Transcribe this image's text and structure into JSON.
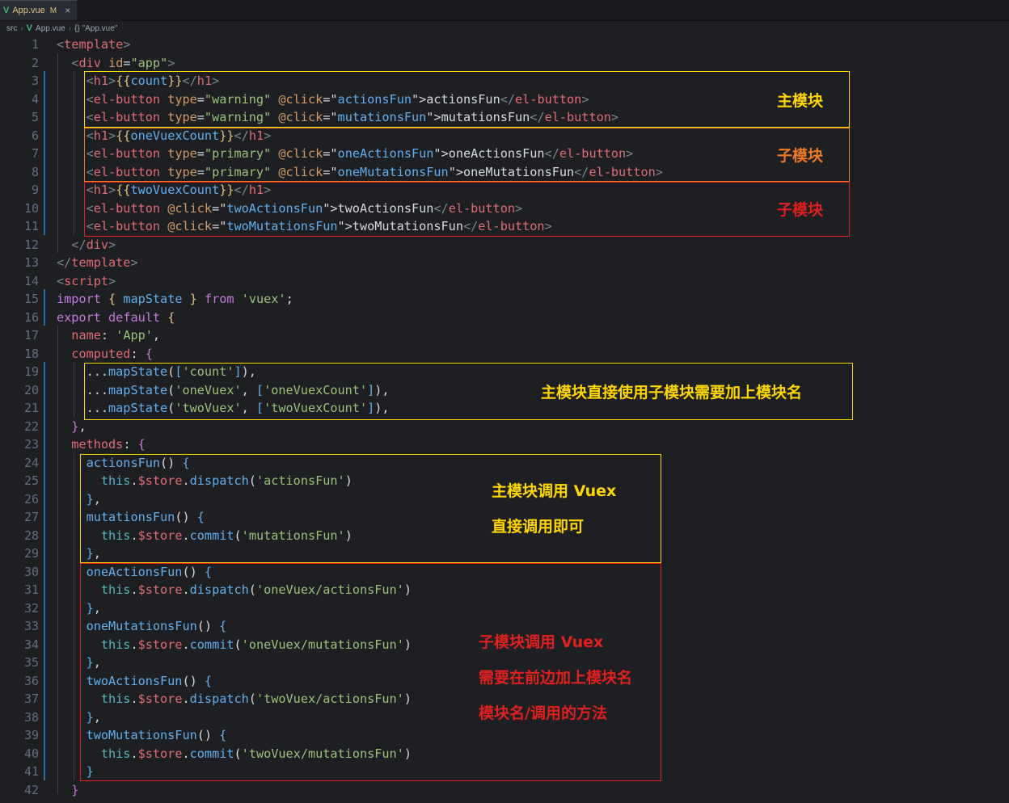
{
  "tab": {
    "icon": "vue-icon",
    "filename": "App.vue",
    "modified": "M",
    "close": "×"
  },
  "breadcrumb": {
    "folder": "src",
    "file": "App.vue",
    "symbol": "{} \"App.vue\""
  },
  "line_numbers": [
    "1",
    "2",
    "3",
    "4",
    "5",
    "6",
    "7",
    "8",
    "9",
    "10",
    "11",
    "12",
    "13",
    "14",
    "15",
    "16",
    "17",
    "18",
    "19",
    "20",
    "21",
    "22",
    "23",
    "24",
    "25",
    "26",
    "27",
    "28",
    "29",
    "30",
    "31",
    "32",
    "33",
    "34",
    "35",
    "36",
    "37",
    "38",
    "39",
    "40",
    "41",
    "42"
  ],
  "code_lines": [
    [
      [
        "tg",
        "<"
      ],
      [
        "tn",
        "template"
      ],
      [
        "tg",
        ">"
      ]
    ],
    [
      [
        "pl",
        "  "
      ],
      [
        "tg",
        "<"
      ],
      [
        "tn",
        "div"
      ],
      [
        "pl",
        " "
      ],
      [
        "at",
        "id"
      ],
      [
        "pl",
        "="
      ],
      [
        "sv",
        "\"app\""
      ],
      [
        "tg",
        ">"
      ]
    ],
    [
      [
        "pl",
        "    "
      ],
      [
        "tg",
        "<"
      ],
      [
        "tn",
        "h1"
      ],
      [
        "tg",
        ">"
      ],
      [
        "br",
        "{{"
      ],
      [
        "bv",
        "count"
      ],
      [
        "br",
        "}}"
      ],
      [
        "tg",
        "</"
      ],
      [
        "tn",
        "h1"
      ],
      [
        "tg",
        ">"
      ]
    ],
    [
      [
        "pl",
        "    "
      ],
      [
        "tg",
        "<"
      ],
      [
        "tn",
        "el-button"
      ],
      [
        "pl",
        " "
      ],
      [
        "at",
        "type"
      ],
      [
        "pl",
        "="
      ],
      [
        "sv",
        "\"warning\""
      ],
      [
        "pl",
        " "
      ],
      [
        "at",
        "@click"
      ],
      [
        "pl",
        "=\""
      ],
      [
        "bv",
        "actionsFun"
      ],
      [
        "pl",
        "\">actionsFun"
      ],
      [
        "tg",
        "</"
      ],
      [
        "tn",
        "el-button"
      ],
      [
        "tg",
        ">"
      ]
    ],
    [
      [
        "pl",
        "    "
      ],
      [
        "tg",
        "<"
      ],
      [
        "tn",
        "el-button"
      ],
      [
        "pl",
        " "
      ],
      [
        "at",
        "type"
      ],
      [
        "pl",
        "="
      ],
      [
        "sv",
        "\"warning\""
      ],
      [
        "pl",
        " "
      ],
      [
        "at",
        "@click"
      ],
      [
        "pl",
        "=\""
      ],
      [
        "bv",
        "mutationsFun"
      ],
      [
        "pl",
        "\">mutationsFun"
      ],
      [
        "tg",
        "</"
      ],
      [
        "tn",
        "el-button"
      ],
      [
        "tg",
        ">"
      ]
    ],
    [
      [
        "pl",
        "    "
      ],
      [
        "tg",
        "<"
      ],
      [
        "tn",
        "h1"
      ],
      [
        "tg",
        ">"
      ],
      [
        "br",
        "{{"
      ],
      [
        "bv",
        "oneVuexCount"
      ],
      [
        "br",
        "}}"
      ],
      [
        "tg",
        "</"
      ],
      [
        "tn",
        "h1"
      ],
      [
        "tg",
        ">"
      ]
    ],
    [
      [
        "pl",
        "    "
      ],
      [
        "tg",
        "<"
      ],
      [
        "tn",
        "el-button"
      ],
      [
        "pl",
        " "
      ],
      [
        "at",
        "type"
      ],
      [
        "pl",
        "="
      ],
      [
        "sv",
        "\"primary\""
      ],
      [
        "pl",
        " "
      ],
      [
        "at",
        "@click"
      ],
      [
        "pl",
        "=\""
      ],
      [
        "bv",
        "oneActionsFun"
      ],
      [
        "pl",
        "\">oneActionsFun"
      ],
      [
        "tg",
        "</"
      ],
      [
        "tn",
        "el-button"
      ],
      [
        "tg",
        ">"
      ]
    ],
    [
      [
        "pl",
        "    "
      ],
      [
        "tg",
        "<"
      ],
      [
        "tn",
        "el-button"
      ],
      [
        "pl",
        " "
      ],
      [
        "at",
        "type"
      ],
      [
        "pl",
        "="
      ],
      [
        "sv",
        "\"primary\""
      ],
      [
        "pl",
        " "
      ],
      [
        "at",
        "@click"
      ],
      [
        "pl",
        "=\""
      ],
      [
        "bv",
        "oneMutationsFun"
      ],
      [
        "pl",
        "\">oneMutationsFun"
      ],
      [
        "tg",
        "</"
      ],
      [
        "tn",
        "el-button"
      ],
      [
        "tg",
        ">"
      ]
    ],
    [
      [
        "pl",
        "    "
      ],
      [
        "tg",
        "<"
      ],
      [
        "tn",
        "h1"
      ],
      [
        "tg",
        ">"
      ],
      [
        "br",
        "{{"
      ],
      [
        "bv",
        "twoVuexCount"
      ],
      [
        "br",
        "}}"
      ],
      [
        "tg",
        "</"
      ],
      [
        "tn",
        "h1"
      ],
      [
        "tg",
        ">"
      ]
    ],
    [
      [
        "pl",
        "    "
      ],
      [
        "tg",
        "<"
      ],
      [
        "tn",
        "el-button"
      ],
      [
        "pl",
        " "
      ],
      [
        "at",
        "@click"
      ],
      [
        "pl",
        "=\""
      ],
      [
        "bv",
        "twoActionsFun"
      ],
      [
        "pl",
        "\">twoActionsFun"
      ],
      [
        "tg",
        "</"
      ],
      [
        "tn",
        "el-button"
      ],
      [
        "tg",
        ">"
      ]
    ],
    [
      [
        "pl",
        "    "
      ],
      [
        "tg",
        "<"
      ],
      [
        "tn",
        "el-button"
      ],
      [
        "pl",
        " "
      ],
      [
        "at",
        "@click"
      ],
      [
        "pl",
        "=\""
      ],
      [
        "bv",
        "twoMutationsFun"
      ],
      [
        "pl",
        "\">twoMutationsFun"
      ],
      [
        "tg",
        "</"
      ],
      [
        "tn",
        "el-button"
      ],
      [
        "tg",
        ">"
      ]
    ],
    [
      [
        "pl",
        "  "
      ],
      [
        "tg",
        "</"
      ],
      [
        "tn",
        "div"
      ],
      [
        "tg",
        ">"
      ]
    ],
    [
      [
        "tg",
        "</"
      ],
      [
        "tn",
        "template"
      ],
      [
        "tg",
        ">"
      ]
    ],
    [
      [
        "tg",
        "<"
      ],
      [
        "tn",
        "script"
      ],
      [
        "tg",
        ">"
      ]
    ],
    [
      [
        "kw",
        "import"
      ],
      [
        "pl",
        " "
      ],
      [
        "br",
        "{"
      ],
      [
        "pl",
        " "
      ],
      [
        "bv",
        "mapState"
      ],
      [
        "pl",
        " "
      ],
      [
        "br",
        "}"
      ],
      [
        "pl",
        " "
      ],
      [
        "kw",
        "from"
      ],
      [
        "pl",
        " "
      ],
      [
        "sv",
        "'vuex'"
      ],
      [
        "pl",
        ";"
      ]
    ],
    [
      [
        "kw",
        "export"
      ],
      [
        "pl",
        " "
      ],
      [
        "kw",
        "default"
      ],
      [
        "pl",
        " "
      ],
      [
        "br",
        "{"
      ]
    ],
    [
      [
        "pl",
        "  "
      ],
      [
        "pr",
        "name"
      ],
      [
        "pl",
        ": "
      ],
      [
        "sv",
        "'App'"
      ],
      [
        "pl",
        ","
      ]
    ],
    [
      [
        "pl",
        "  "
      ],
      [
        "pr",
        "computed"
      ],
      [
        "pl",
        ": "
      ],
      [
        "pp",
        "{"
      ]
    ],
    [
      [
        "pl",
        "    ..."
      ],
      [
        "fn",
        "mapState"
      ],
      [
        "pl",
        "("
      ],
      [
        "bv",
        "["
      ],
      [
        "sv",
        "'count'"
      ],
      [
        "bv",
        "]"
      ],
      [
        "pl",
        "),"
      ]
    ],
    [
      [
        "pl",
        "    ..."
      ],
      [
        "fn",
        "mapState"
      ],
      [
        "pl",
        "("
      ],
      [
        "sv",
        "'oneVuex'"
      ],
      [
        "pl",
        ", "
      ],
      [
        "bv",
        "["
      ],
      [
        "sv",
        "'oneVuexCount'"
      ],
      [
        "bv",
        "]"
      ],
      [
        "pl",
        "),"
      ]
    ],
    [
      [
        "pl",
        "    ..."
      ],
      [
        "fn",
        "mapState"
      ],
      [
        "pl",
        "("
      ],
      [
        "sv",
        "'twoVuex'"
      ],
      [
        "pl",
        ", "
      ],
      [
        "bv",
        "["
      ],
      [
        "sv",
        "'twoVuexCount'"
      ],
      [
        "bv",
        "]"
      ],
      [
        "pl",
        "),"
      ]
    ],
    [
      [
        "pl",
        "  "
      ],
      [
        "pp",
        "}"
      ],
      [
        "pl",
        ","
      ]
    ],
    [
      [
        "pl",
        "  "
      ],
      [
        "pr",
        "methods"
      ],
      [
        "pl",
        ": "
      ],
      [
        "pp",
        "{"
      ]
    ],
    [
      [
        "pl",
        "    "
      ],
      [
        "fn",
        "actionsFun"
      ],
      [
        "pl",
        "() "
      ],
      [
        "bv",
        "{"
      ]
    ],
    [
      [
        "pl",
        "      "
      ],
      [
        "th",
        "this"
      ],
      [
        "pl",
        "."
      ],
      [
        "pr",
        "$store"
      ],
      [
        "pl",
        "."
      ],
      [
        "fn",
        "dispatch"
      ],
      [
        "pl",
        "("
      ],
      [
        "sv",
        "'actionsFun'"
      ],
      [
        "pl",
        ")"
      ]
    ],
    [
      [
        "pl",
        "    "
      ],
      [
        "bv",
        "}"
      ],
      [
        "pl",
        ","
      ]
    ],
    [
      [
        "pl",
        "    "
      ],
      [
        "fn",
        "mutationsFun"
      ],
      [
        "pl",
        "() "
      ],
      [
        "bv",
        "{"
      ]
    ],
    [
      [
        "pl",
        "      "
      ],
      [
        "th",
        "this"
      ],
      [
        "pl",
        "."
      ],
      [
        "pr",
        "$store"
      ],
      [
        "pl",
        "."
      ],
      [
        "fn",
        "commit"
      ],
      [
        "pl",
        "("
      ],
      [
        "sv",
        "'mutationsFun'"
      ],
      [
        "pl",
        ")"
      ]
    ],
    [
      [
        "pl",
        "    "
      ],
      [
        "bv",
        "}"
      ],
      [
        "pl",
        ","
      ]
    ],
    [
      [
        "pl",
        "    "
      ],
      [
        "fn",
        "oneActionsFun"
      ],
      [
        "pl",
        "() "
      ],
      [
        "bv",
        "{"
      ]
    ],
    [
      [
        "pl",
        "      "
      ],
      [
        "th",
        "this"
      ],
      [
        "pl",
        "."
      ],
      [
        "pr",
        "$store"
      ],
      [
        "pl",
        "."
      ],
      [
        "fn",
        "dispatch"
      ],
      [
        "pl",
        "("
      ],
      [
        "sv",
        "'oneVuex/actionsFun'"
      ],
      [
        "pl",
        ")"
      ]
    ],
    [
      [
        "pl",
        "    "
      ],
      [
        "bv",
        "}"
      ],
      [
        "pl",
        ","
      ]
    ],
    [
      [
        "pl",
        "    "
      ],
      [
        "fn",
        "oneMutationsFun"
      ],
      [
        "pl",
        "() "
      ],
      [
        "bv",
        "{"
      ]
    ],
    [
      [
        "pl",
        "      "
      ],
      [
        "th",
        "this"
      ],
      [
        "pl",
        "."
      ],
      [
        "pr",
        "$store"
      ],
      [
        "pl",
        "."
      ],
      [
        "fn",
        "commit"
      ],
      [
        "pl",
        "("
      ],
      [
        "sv",
        "'oneVuex/mutationsFun'"
      ],
      [
        "pl",
        ")"
      ]
    ],
    [
      [
        "pl",
        "    "
      ],
      [
        "bv",
        "}"
      ],
      [
        "pl",
        ","
      ]
    ],
    [
      [
        "pl",
        "    "
      ],
      [
        "fn",
        "twoActionsFun"
      ],
      [
        "pl",
        "() "
      ],
      [
        "bv",
        "{"
      ]
    ],
    [
      [
        "pl",
        "      "
      ],
      [
        "th",
        "this"
      ],
      [
        "pl",
        "."
      ],
      [
        "pr",
        "$store"
      ],
      [
        "pl",
        "."
      ],
      [
        "fn",
        "dispatch"
      ],
      [
        "pl",
        "("
      ],
      [
        "sv",
        "'twoVuex/actionsFun'"
      ],
      [
        "pl",
        ")"
      ]
    ],
    [
      [
        "pl",
        "    "
      ],
      [
        "bv",
        "}"
      ],
      [
        "pl",
        ","
      ]
    ],
    [
      [
        "pl",
        "    "
      ],
      [
        "fn",
        "twoMutationsFun"
      ],
      [
        "pl",
        "() "
      ],
      [
        "bv",
        "{"
      ]
    ],
    [
      [
        "pl",
        "      "
      ],
      [
        "th",
        "this"
      ],
      [
        "pl",
        "."
      ],
      [
        "pr",
        "$store"
      ],
      [
        "pl",
        "."
      ],
      [
        "fn",
        "commit"
      ],
      [
        "pl",
        "("
      ],
      [
        "sv",
        "'twoVuex/mutationsFun'"
      ],
      [
        "pl",
        ")"
      ]
    ],
    [
      [
        "pl",
        "    "
      ],
      [
        "bv",
        "}"
      ]
    ],
    [
      [
        "pl",
        "  "
      ],
      [
        "pp",
        "}"
      ]
    ]
  ],
  "annotations": {
    "main_module": "主模块",
    "sub_module_orange": "子模块",
    "sub_module_red": "子模块",
    "computed_note": "主模块直接使用子模块需要加上模块名",
    "main_call_line1": "主模块调用 Vuex",
    "main_call_line2": "直接调用即可",
    "sub_call_line1": "子模块调用 Vuex",
    "sub_call_line2": "需要在前边加上模块名",
    "sub_call_line3": "模块名/调用的方法"
  },
  "colors": {
    "yellow": "#ffd700",
    "orange": "#ef7a24",
    "red": "#e02020",
    "background": "#1e1f22"
  }
}
